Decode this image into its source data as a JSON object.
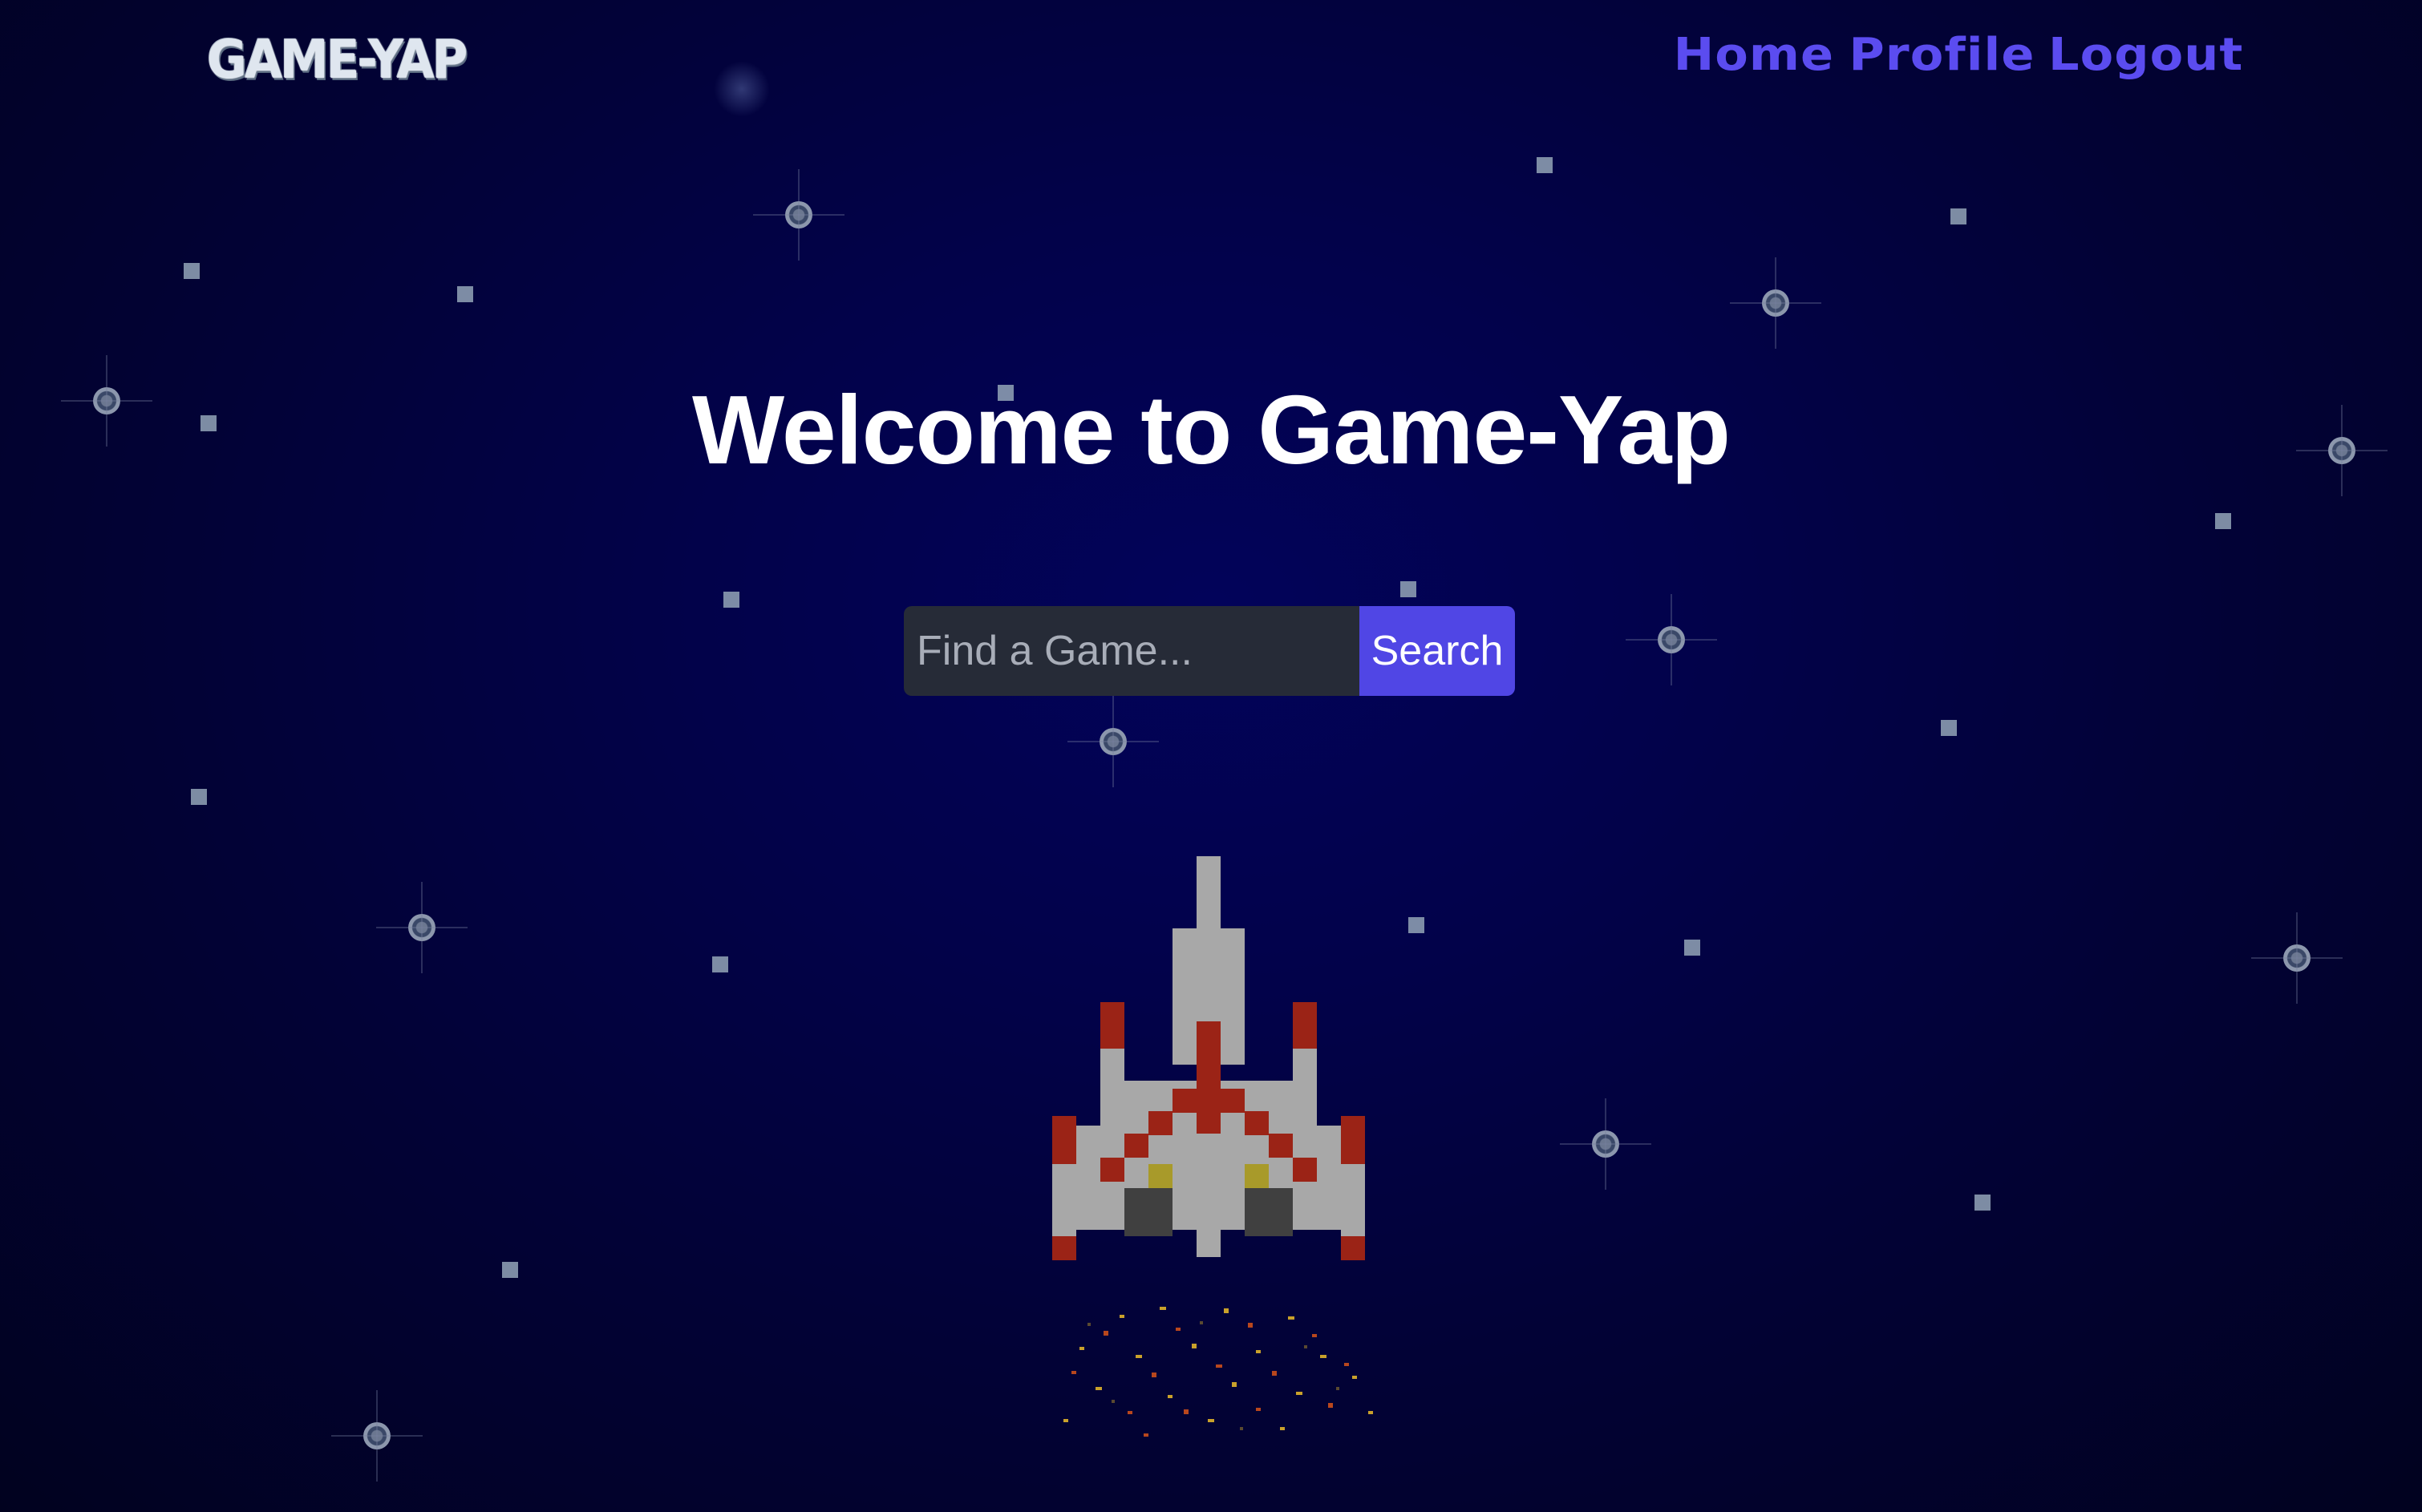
{
  "header": {
    "logo_text": "GAME-YAP",
    "nav": {
      "home": "Home",
      "profile": "Profile",
      "logout": "Logout"
    }
  },
  "hero": {
    "title": "Welcome to Game-Yap"
  },
  "search": {
    "placeholder": "Find a Game...",
    "value": "",
    "button_label": "Search"
  },
  "colors": {
    "background": "#020238",
    "accent": "#5046e5",
    "nav_link": "#5b4cf0",
    "input_bg": "#262b37"
  },
  "icons": {
    "ship": "pixel-spaceship-icon",
    "exhaust": "exhaust-particles-icon",
    "stars": "star-icon"
  }
}
